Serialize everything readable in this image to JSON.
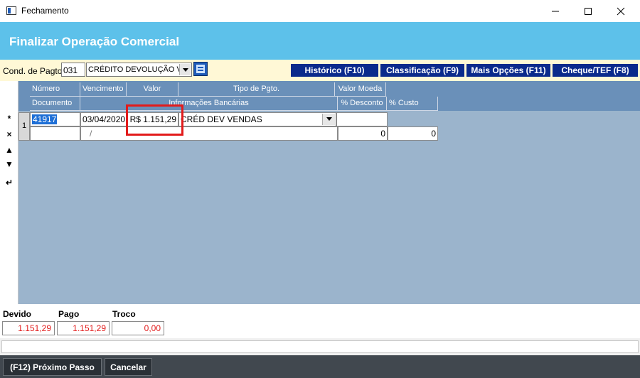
{
  "window": {
    "title": "Fechamento"
  },
  "header": {
    "title": "Finalizar Operação Comercial"
  },
  "toolbar": {
    "cond_label": "Cond. de Pagto",
    "cond_code": "031",
    "cond_value": "CRÉDITO DEVOLUÇÃO V",
    "buttons": [
      {
        "label": "Histórico (F10)"
      },
      {
        "label": "Classificação (F9)"
      },
      {
        "label": "Mais Opções (F11)"
      },
      {
        "label": "Cheque/TEF (F8)"
      }
    ]
  },
  "grid": {
    "headers_row1": [
      "Número",
      "Vencimento",
      "Valor",
      "Tipo de Pgto.",
      "Valor Moeda"
    ],
    "headers_row2": [
      "Documento",
      "Informações Bancárias",
      "% Desconto",
      "% Custo"
    ],
    "side_buttons": [
      "*",
      "×",
      "▲",
      "▼",
      "↵"
    ],
    "rows": [
      {
        "index": "1",
        "numero": "41917",
        "vencimento": "03/04/2020",
        "valor": "R$ 1.151,29",
        "tipo": "CRÉD DEV VENDAS",
        "valor_moeda": "",
        "documento": "",
        "info_bancarias": "/",
        "desconto": "0",
        "custo": "0"
      }
    ]
  },
  "totals": {
    "devido_label": "Devido",
    "devido_value": "1.151,29",
    "pago_label": "Pago",
    "pago_value": "1.151,29",
    "troco_label": "Troco",
    "troco_value": "0,00"
  },
  "footer": {
    "next_label": "(F12) Próximo Passo",
    "cancel_label": "Cancelar"
  },
  "colors": {
    "banner": "#5dc1ea",
    "toolbar_button": "#0b2a8c",
    "grid_header": "#6a90b9",
    "grid_body": "#9bb4cc",
    "highlight": "#e21b1b",
    "footer": "#41484f"
  }
}
